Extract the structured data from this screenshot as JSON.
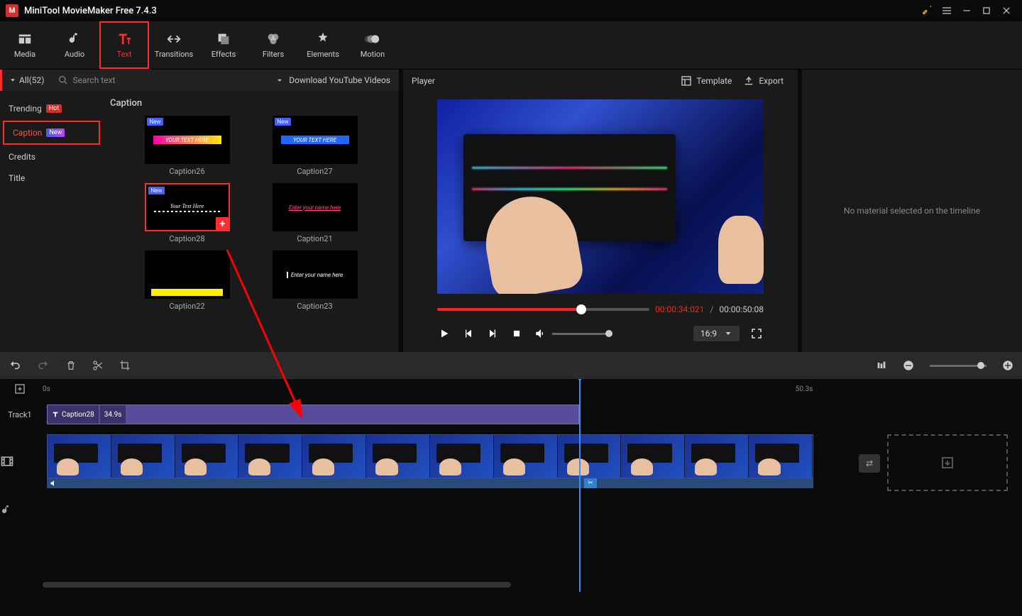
{
  "app": {
    "title": "MiniTool MovieMaker Free 7.4.3"
  },
  "toolbar": [
    {
      "id": "media",
      "label": "Media"
    },
    {
      "id": "audio",
      "label": "Audio"
    },
    {
      "id": "text",
      "label": "Text",
      "active": true
    },
    {
      "id": "transitions",
      "label": "Transitions"
    },
    {
      "id": "effects",
      "label": "Effects"
    },
    {
      "id": "filters",
      "label": "Filters"
    },
    {
      "id": "elements",
      "label": "Elements"
    },
    {
      "id": "motion",
      "label": "Motion"
    }
  ],
  "leftbar": {
    "all": "All(52)",
    "search_placeholder": "Search text",
    "download_yt": "Download YouTube Videos"
  },
  "categories": [
    {
      "label": "Trending",
      "badge": "Hot"
    },
    {
      "label": "Caption",
      "badge": "New",
      "active": true
    },
    {
      "label": "Credits"
    },
    {
      "label": "Title"
    }
  ],
  "thumbs_heading": "Caption",
  "thumbs": [
    {
      "name": "Caption26",
      "new": true,
      "text": "YOUR TEXT HERE",
      "stripColor": "linear-gradient(90deg,#ff00aa,#ffee00)"
    },
    {
      "name": "Caption27",
      "new": true,
      "text": "YOUR TEXT HERE",
      "stripColor": "#2266ff"
    },
    {
      "name": "Caption28",
      "new": true,
      "text": "Your Text Here",
      "selected": true,
      "hasAdd": true
    },
    {
      "name": "Caption21",
      "text": "Enter your name here"
    },
    {
      "name": "Caption22",
      "text": ""
    },
    {
      "name": "Caption23",
      "text": "Enter your name here"
    }
  ],
  "player": {
    "label": "Player",
    "template": "Template",
    "export": "Export",
    "current_time": "00:00:34:021",
    "total_time": "00:00:50:08",
    "ratio": "16:9",
    "no_selection": "No material selected on the timeline"
  },
  "timeline": {
    "start_tick": "0s",
    "end_tick": "50.3s",
    "track1": "Track1",
    "clip_name": "Caption28",
    "clip_duration": "34.9s"
  }
}
